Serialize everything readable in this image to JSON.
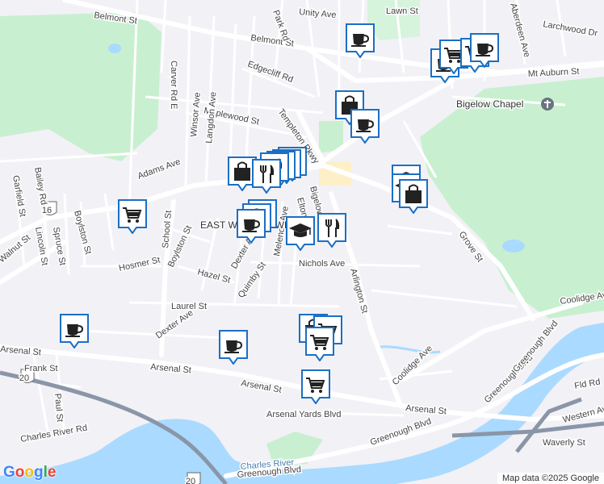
{
  "map": {
    "attribution": "Map data ©2025 Google",
    "logo_letters": [
      "G",
      "o",
      "o",
      "g",
      "l",
      "e"
    ],
    "colors": {
      "water": "#aadaff",
      "park": "#c8f0d0",
      "road": "#ffffff",
      "highway": "#8a96a8",
      "marker_fill": "#ffffff",
      "marker_border": "#1b6fc4",
      "icon": "#222222"
    },
    "street_labels": [
      {
        "id": "belmont-st-1",
        "text": "Belmont St"
      },
      {
        "id": "belmont-st-2",
        "text": "Belmont St"
      },
      {
        "id": "unity-ave",
        "text": "Unity Ave"
      },
      {
        "id": "lawn-st",
        "text": "Lawn St"
      },
      {
        "id": "park-rd",
        "text": "Park Rd"
      },
      {
        "id": "aberdeen-ave",
        "text": "Aberdeen Ave"
      },
      {
        "id": "larchwood-dr",
        "text": "Larchwood Dr"
      },
      {
        "id": "mt-auburn-st",
        "text": "Mt Auburn St"
      },
      {
        "id": "carver-rd-e",
        "text": "Carver Rd E"
      },
      {
        "id": "edgecliff-rd",
        "text": "Edgecliff Rd"
      },
      {
        "id": "maplewood-st",
        "text": "Maplewood St"
      },
      {
        "id": "templeton-pkwy",
        "text": "Templeton Pkwy"
      },
      {
        "id": "winsor-ave",
        "text": "Winsor Ave"
      },
      {
        "id": "langdon-ave",
        "text": "Langdon Ave"
      },
      {
        "id": "adams-ave",
        "text": "Adams Ave"
      },
      {
        "id": "bailey-rd",
        "text": "Bailey Rd"
      },
      {
        "id": "garfield-st",
        "text": "Garfield St"
      },
      {
        "id": "lincoln-st",
        "text": "Lincoln St"
      },
      {
        "id": "spruce-st",
        "text": "Spruce St"
      },
      {
        "id": "boylston-st-1",
        "text": "Boylston St"
      },
      {
        "id": "boylston-st-2",
        "text": "Boylston St"
      },
      {
        "id": "walnut-st",
        "text": "Walnut St"
      },
      {
        "id": "school-st",
        "text": "School St"
      },
      {
        "id": "hosmer-st",
        "text": "Hosmer St"
      },
      {
        "id": "hazel-st",
        "text": "Hazel St"
      },
      {
        "id": "dexter-ave-1",
        "text": "Dexter Ave"
      },
      {
        "id": "dexter-ave-2",
        "text": "Dexter Ave"
      },
      {
        "id": "quimby-st",
        "text": "Quimby St"
      },
      {
        "id": "melendy-ave",
        "text": "Melendy Ave"
      },
      {
        "id": "nichols-ave",
        "text": "Nichols Ave"
      },
      {
        "id": "arlington-st",
        "text": "Arlington St"
      },
      {
        "id": "grove-st",
        "text": "Grove St"
      },
      {
        "id": "coolidge-ave-1",
        "text": "Coolidge Ave"
      },
      {
        "id": "coolidge-ave-2",
        "text": "Coolidge Ave"
      },
      {
        "id": "laurel-st",
        "text": "Laurel St"
      },
      {
        "id": "arsenal-st-1",
        "text": "Arsenal St"
      },
      {
        "id": "arsenal-st-2",
        "text": "Arsenal St"
      },
      {
        "id": "arsenal-st-3",
        "text": "Arsenal St"
      },
      {
        "id": "arsenal-st-4",
        "text": "Arsenal St"
      },
      {
        "id": "frank-st",
        "text": "Frank St"
      },
      {
        "id": "paul-st",
        "text": "Paul St"
      },
      {
        "id": "charles-river-rd",
        "text": "Charles River Rd"
      },
      {
        "id": "arsenal-yards-blvd",
        "text": "Arsenal Yards Blvd"
      },
      {
        "id": "greenough-blvd-1",
        "text": "Greenough Blvd"
      },
      {
        "id": "greenough-blvd-2",
        "text": "Greenough Blvd"
      },
      {
        "id": "greenough-blvd-3",
        "text": "Greenough Blvd"
      },
      {
        "id": "greenough-blvd-4",
        "text": "Greenough Blvd"
      },
      {
        "id": "western-ave",
        "text": "Western Ave"
      },
      {
        "id": "waverly-st",
        "text": "Waverly St"
      },
      {
        "id": "fld-rd",
        "text": "Fld Rd"
      },
      {
        "id": "charles-river",
        "text": "Charles River"
      },
      {
        "id": "bigelow-chapel",
        "text": "Bigelow Chapel"
      },
      {
        "id": "east-watertown",
        "text": "EAST WATERTOWN"
      },
      {
        "id": "bigelow-ave",
        "text": "Bigelow Ave"
      },
      {
        "id": "elton-ave",
        "text": "Elton Ave"
      },
      {
        "id": "route-16",
        "text": "16"
      },
      {
        "id": "route-20-a",
        "text": "20"
      },
      {
        "id": "route-20-b",
        "text": "20"
      }
    ],
    "markers": [
      {
        "id": "m1",
        "type": "cafe",
        "icon": "coffee-cup-icon"
      },
      {
        "id": "m2",
        "type": "cafe",
        "icon": "coffee-cup-icon"
      },
      {
        "id": "m3",
        "type": "grocery",
        "icon": "shopping-cart-icon"
      },
      {
        "id": "m4",
        "type": "grocery",
        "icon": "shopping-cart-icon"
      },
      {
        "id": "m5",
        "type": "cafe",
        "icon": "coffee-cup-icon"
      },
      {
        "id": "m6",
        "type": "shopping",
        "icon": "shopping-bag-icon"
      },
      {
        "id": "m7",
        "type": "cafe",
        "icon": "coffee-cup-icon"
      },
      {
        "id": "m8",
        "type": "restaurant",
        "icon": "fork-knife-icon"
      },
      {
        "id": "m9",
        "type": "restaurant",
        "icon": "fork-knife-icon"
      },
      {
        "id": "m10",
        "type": "restaurant",
        "icon": "fork-knife-icon"
      },
      {
        "id": "m11",
        "type": "restaurant",
        "icon": "fork-knife-icon"
      },
      {
        "id": "m12",
        "type": "shopping",
        "icon": "shopping-bag-icon"
      },
      {
        "id": "m13",
        "type": "restaurant",
        "icon": "fork-knife-icon"
      },
      {
        "id": "m14",
        "type": "school",
        "icon": "graduation-cap-icon"
      },
      {
        "id": "m15",
        "type": "school",
        "icon": "graduation-cap-icon"
      },
      {
        "id": "m16",
        "type": "shopping",
        "icon": "shopping-bag-icon"
      },
      {
        "id": "m17",
        "type": "shopping",
        "icon": "shopping-bag-icon"
      },
      {
        "id": "m18",
        "type": "shopping",
        "icon": "shopping-bag-icon"
      },
      {
        "id": "m19",
        "type": "restaurant",
        "icon": "fork-knife-icon"
      },
      {
        "id": "m20",
        "type": "school",
        "icon": "graduation-cap-icon"
      },
      {
        "id": "m21",
        "type": "cafe",
        "icon": "coffee-cup-icon"
      },
      {
        "id": "m22",
        "type": "grocery",
        "icon": "shopping-cart-icon"
      },
      {
        "id": "m23",
        "type": "cafe",
        "icon": "coffee-cup-icon"
      },
      {
        "id": "m24",
        "type": "shopping",
        "icon": "shopping-bag-icon"
      },
      {
        "id": "m25",
        "type": "grocery",
        "icon": "shopping-cart-icon"
      },
      {
        "id": "m26",
        "type": "grocery",
        "icon": "shopping-cart-icon"
      },
      {
        "id": "m27",
        "type": "cafe",
        "icon": "coffee-cup-icon"
      },
      {
        "id": "m28",
        "type": "grocery",
        "icon": "shopping-cart-icon"
      }
    ]
  }
}
